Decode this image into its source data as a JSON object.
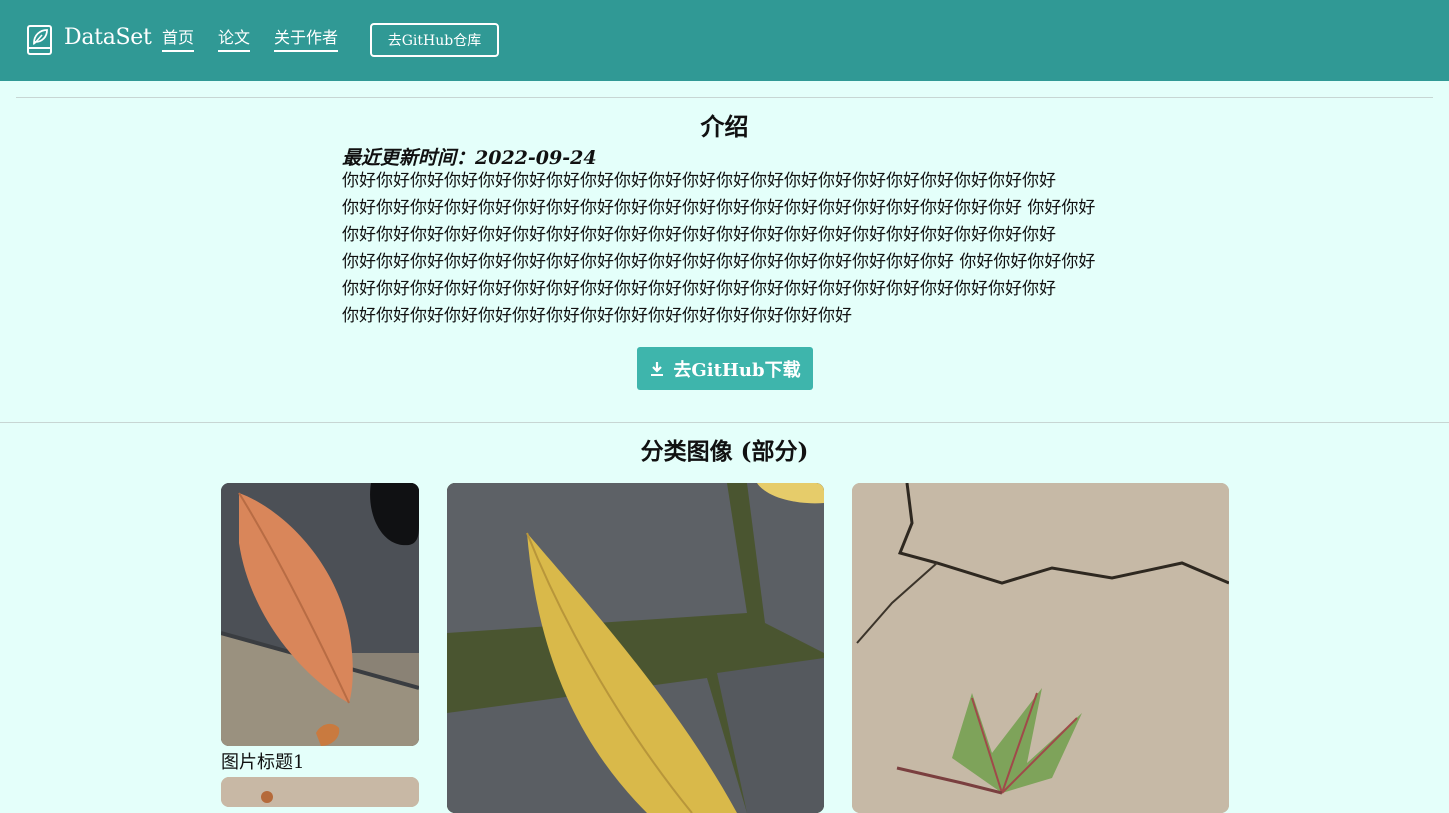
{
  "header": {
    "brand": "DataSet",
    "nav": [
      "首页",
      "论文",
      "关于作者"
    ],
    "github_button": "去GitHub仓库"
  },
  "intro": {
    "title": "介绍",
    "updated": "最近更新时间：2022-09-24",
    "lines": [
      "你好你好你好你好你好你好你好你好你好你好你好你好你好你好你好你好你好你好你好你好你好",
      "你好你好你好你好你好你好你好你好你好你好你好你好你好你好你好你好你好你好你好你好 你好你好",
      "你好你好你好你好你好你好你好你好你好你好你好你好你好你好你好你好你好你好你好你好你好",
      "你好你好你好你好你好你好你好你好你好你好你好你好你好你好你好你好你好你好 你好你好你好你好",
      "你好你好你好你好你好你好你好你好你好你好你好你好你好你好你好你好你好你好你好你好你好",
      "你好你好你好你好你好你好你好你好你好你好你好你好你好你好你好"
    ],
    "download_button": "去GitHub下载"
  },
  "gallery": {
    "title": "分类图像 (部分)",
    "caption_1": "图片标题1"
  },
  "colors": {
    "header_bg": "#309995",
    "page_bg": "#e4fffa",
    "download_bg": "#3eb5ac"
  }
}
